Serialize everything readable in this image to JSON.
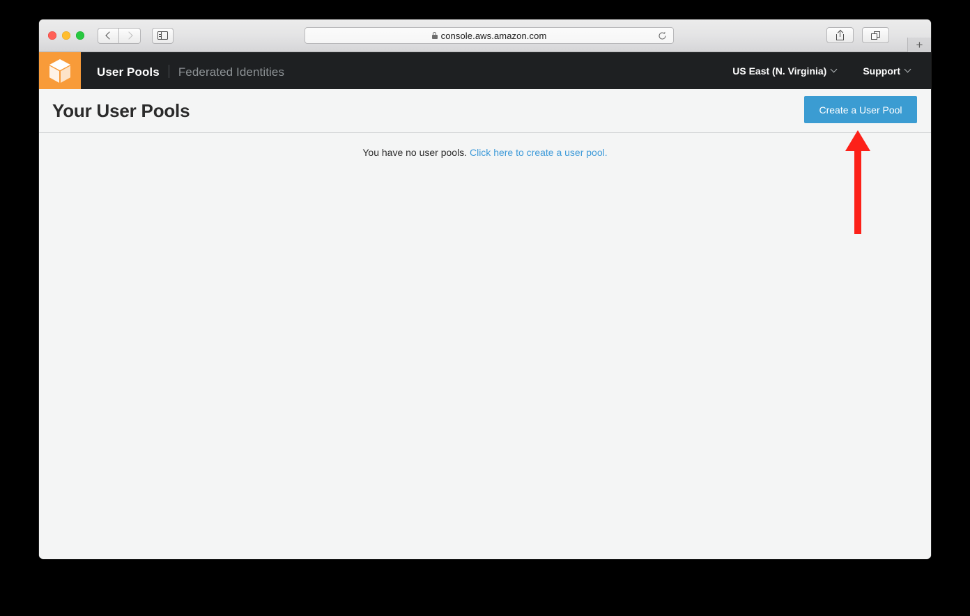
{
  "browser": {
    "traffic_lights": [
      "close",
      "minimize",
      "zoom"
    ],
    "back_label": "Back",
    "forward_label": "Forward",
    "sidebar_label": "Show Sidebar",
    "url": "console.aws.amazon.com",
    "url_secure": true,
    "reload_label": "Reload",
    "share_label": "Share",
    "tabs_label": "Show Tab Overview",
    "new_tab_label": "+"
  },
  "aws_nav": {
    "service_icon": "cognito-cube-icon",
    "links": [
      {
        "label": "User Pools",
        "active": true
      },
      {
        "label": "Federated Identities",
        "active": false
      }
    ],
    "region": "US East (N. Virginia)",
    "support": "Support"
  },
  "page": {
    "title": "Your User Pools",
    "create_button": "Create a User Pool",
    "empty_state_text": "You have no user pools.",
    "empty_state_link": "Click here to create a user pool."
  },
  "annotation": {
    "type": "arrow",
    "direction": "up",
    "color": "#fc2119",
    "points_to": "Create a User Pool"
  },
  "colors": {
    "accent_blue": "#3b9cd2",
    "link_blue": "#3f9bd9",
    "nav_dark": "#1e2022",
    "brand_orange": "#f89b39",
    "page_bg": "#f4f5f5",
    "annotation_red": "#fc2119"
  }
}
